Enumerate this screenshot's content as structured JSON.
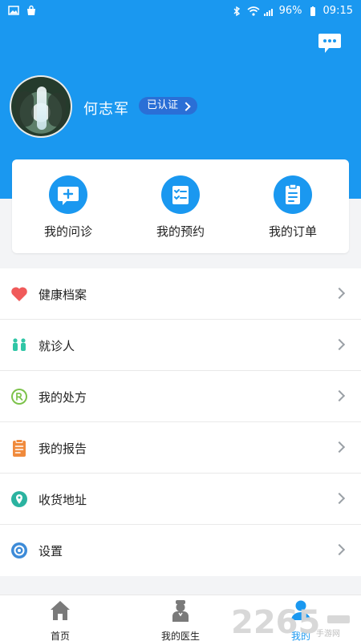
{
  "status_bar": {
    "battery": "96%",
    "time": "09:15"
  },
  "header": {
    "user_name": "何志军",
    "verified_label": "已认证"
  },
  "quick_actions": [
    {
      "label": "我的问诊",
      "icon": "consultation-icon"
    },
    {
      "label": "我的预约",
      "icon": "appointment-icon"
    },
    {
      "label": "我的订单",
      "icon": "order-icon"
    }
  ],
  "menu": [
    {
      "label": "健康档案",
      "icon": "heart-icon"
    },
    {
      "label": "就诊人",
      "icon": "patients-icon"
    },
    {
      "label": "我的处方",
      "icon": "prescription-icon"
    },
    {
      "label": "我的报告",
      "icon": "report-icon"
    },
    {
      "label": "收货地址",
      "icon": "location-icon"
    },
    {
      "label": "设置",
      "icon": "settings-icon"
    }
  ],
  "bottom_tabs": [
    {
      "label": "首页",
      "icon": "home-icon"
    },
    {
      "label": "我的医生",
      "icon": "doctor-icon"
    },
    {
      "label": "我的",
      "icon": "profile-icon",
      "active": true
    }
  ],
  "watermark": {
    "text": "2265",
    "sub_text": "手游网"
  },
  "colors": {
    "primary": "#1a98f0",
    "verified_badge": "#2a6fd6",
    "heart": "#f05a5a",
    "patients": "#30c6a6",
    "prescription": "#7cc24a",
    "report": "#f08a3c",
    "location": "#2bb3a0",
    "settings": "#3d8bd8"
  }
}
